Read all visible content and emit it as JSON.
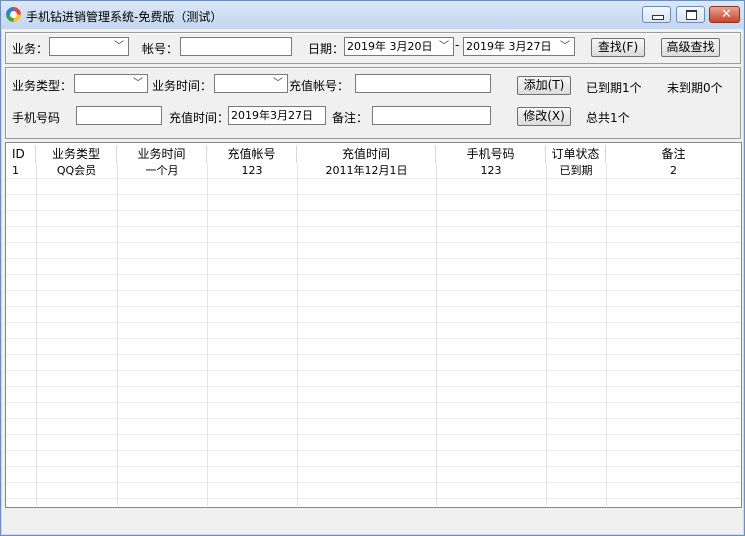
{
  "window": {
    "title": "手机钻进销管理系统-免费版（测试）"
  },
  "search_bar": {
    "business_label": "业务：",
    "business_value": "",
    "account_label": "帐号：",
    "account_value": "",
    "date_label": "日期：",
    "date_from": "2019年 3月20日",
    "date_sep": "-",
    "date_to": "2019年 3月27日",
    "find_button": "查找(F)",
    "advanced_button": "高级查找"
  },
  "entry_form": {
    "biz_type_label": "业务类型：",
    "biz_type_value": "",
    "biz_time_label": "业务时间：",
    "biz_time_value": "",
    "recharge_account_label": "充值帐号：",
    "recharge_account_value": "",
    "add_button": "添加(T)",
    "expired_text": "已到期1个",
    "not_expired_text": "未到期0个",
    "phone_label": "手机号码",
    "phone_value": "",
    "recharge_time_label": "充值时间：",
    "recharge_time_value": "2019年3月27日",
    "note_label": "备注：",
    "note_value": "",
    "modify_button": "修改(X)",
    "total_text": "总共1个"
  },
  "table": {
    "columns": [
      "ID",
      "业务类型",
      "业务时间",
      "充值帐号",
      "充值时间",
      "手机号码",
      "订单状态",
      "备注"
    ],
    "rows": [
      [
        "1",
        "QQ会员",
        "一个月",
        "123",
        "2011年12月1日",
        "123",
        "已到期",
        "2"
      ]
    ]
  },
  "colors": {
    "title_bar": "#c2d6ef",
    "close_button": "#c8442c",
    "panel_bg": "#f0f0f0"
  }
}
